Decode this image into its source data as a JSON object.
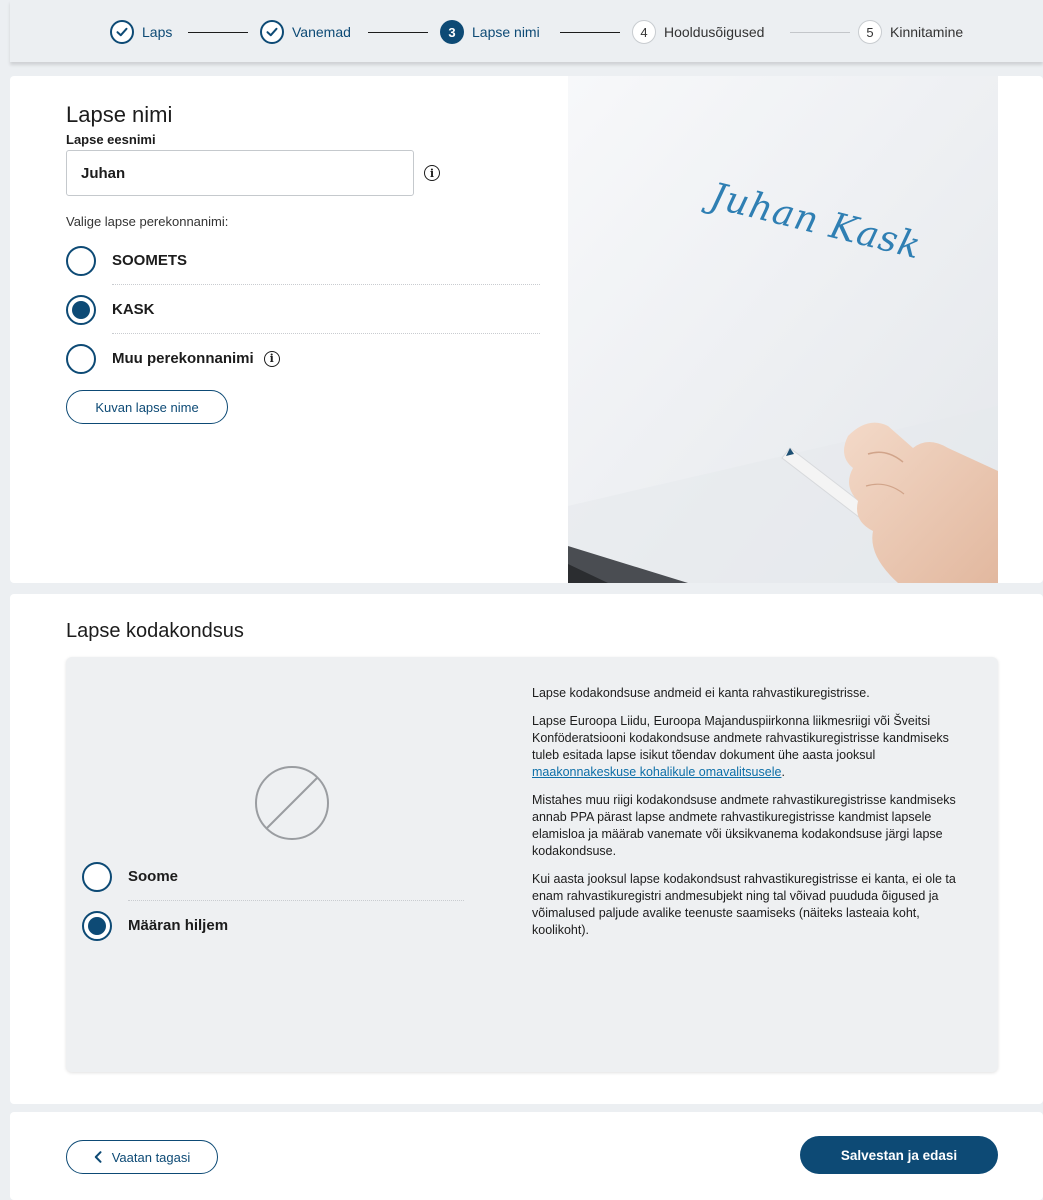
{
  "stepper": {
    "steps": [
      {
        "label": "Laps",
        "state": "done",
        "icon": "check-icon"
      },
      {
        "label": "Vanemad",
        "state": "done",
        "icon": "check-icon"
      },
      {
        "number": "3",
        "label": "Lapse nimi",
        "state": "active"
      },
      {
        "number": "4",
        "label": "Hooldusõigused",
        "state": "todo"
      },
      {
        "number": "5",
        "label": "Kinnitamine",
        "state": "todo"
      }
    ]
  },
  "child_name": {
    "title": "Lapse nimi",
    "first_name_label": "Lapse eesnimi",
    "first_name_value": "Juhan",
    "surname_prompt": "Valige lapse perekonnanimi:",
    "surname_options": [
      {
        "label": "SOOMETS",
        "checked": false
      },
      {
        "label": "KASK",
        "checked": true
      },
      {
        "label": "Muu perekonnanimi",
        "checked": false
      }
    ],
    "show_name_button": "Kuvan lapse nime",
    "signature_text": "Juhan Kask"
  },
  "citizenship": {
    "title": "Lapse kodakondsus",
    "options": [
      {
        "label": "Soome",
        "checked": false
      },
      {
        "label": "Määran hiljem",
        "checked": true
      }
    ],
    "info_paragraphs": [
      "Lapse kodakondsuse andmeid ei kanta rahvastikuregistrisse.",
      "Lapse Euroopa Liidu, Euroopa Majanduspiirkonna liikmesriigi või Šveitsi Konföderatsiooni kodakondsuse andmete rahvastikuregistrisse kandmiseks tuleb esitada lapse isikut tõendav dokument ühe aasta jooksul ",
      "Mistahes muu riigi kodakondsuse andmete rahvastikuregistrisse kandmiseks annab PPA pärast lapse andmete rahvastikuregistrisse kandmist lapsele elamisloa ja määrab vanemate või üksikvanema kodakondsuse järgi lapse kodakondsuse.",
      "Kui aasta jooksul lapse kodakondsust rahvastikuregistrisse ei kanta, ei ole ta enam rahvastikuregistri andmesubjekt ning tal võivad puududa õigused ja võimalused paljude avalike teenuste saamiseks (näiteks lasteaia koht, koolikoht)."
    ],
    "info_link": "maakonnakeskuse kohalikule omavalitsusele",
    "info_link_suffix": "."
  },
  "footer": {
    "back_label": "Vaatan tagasi",
    "next_label": "Salvestan ja edasi"
  },
  "colors": {
    "primary": "#0d4a75",
    "link": "#0d6fa8",
    "signature": "#2f7fb3",
    "page_bg": "#eceff2"
  }
}
